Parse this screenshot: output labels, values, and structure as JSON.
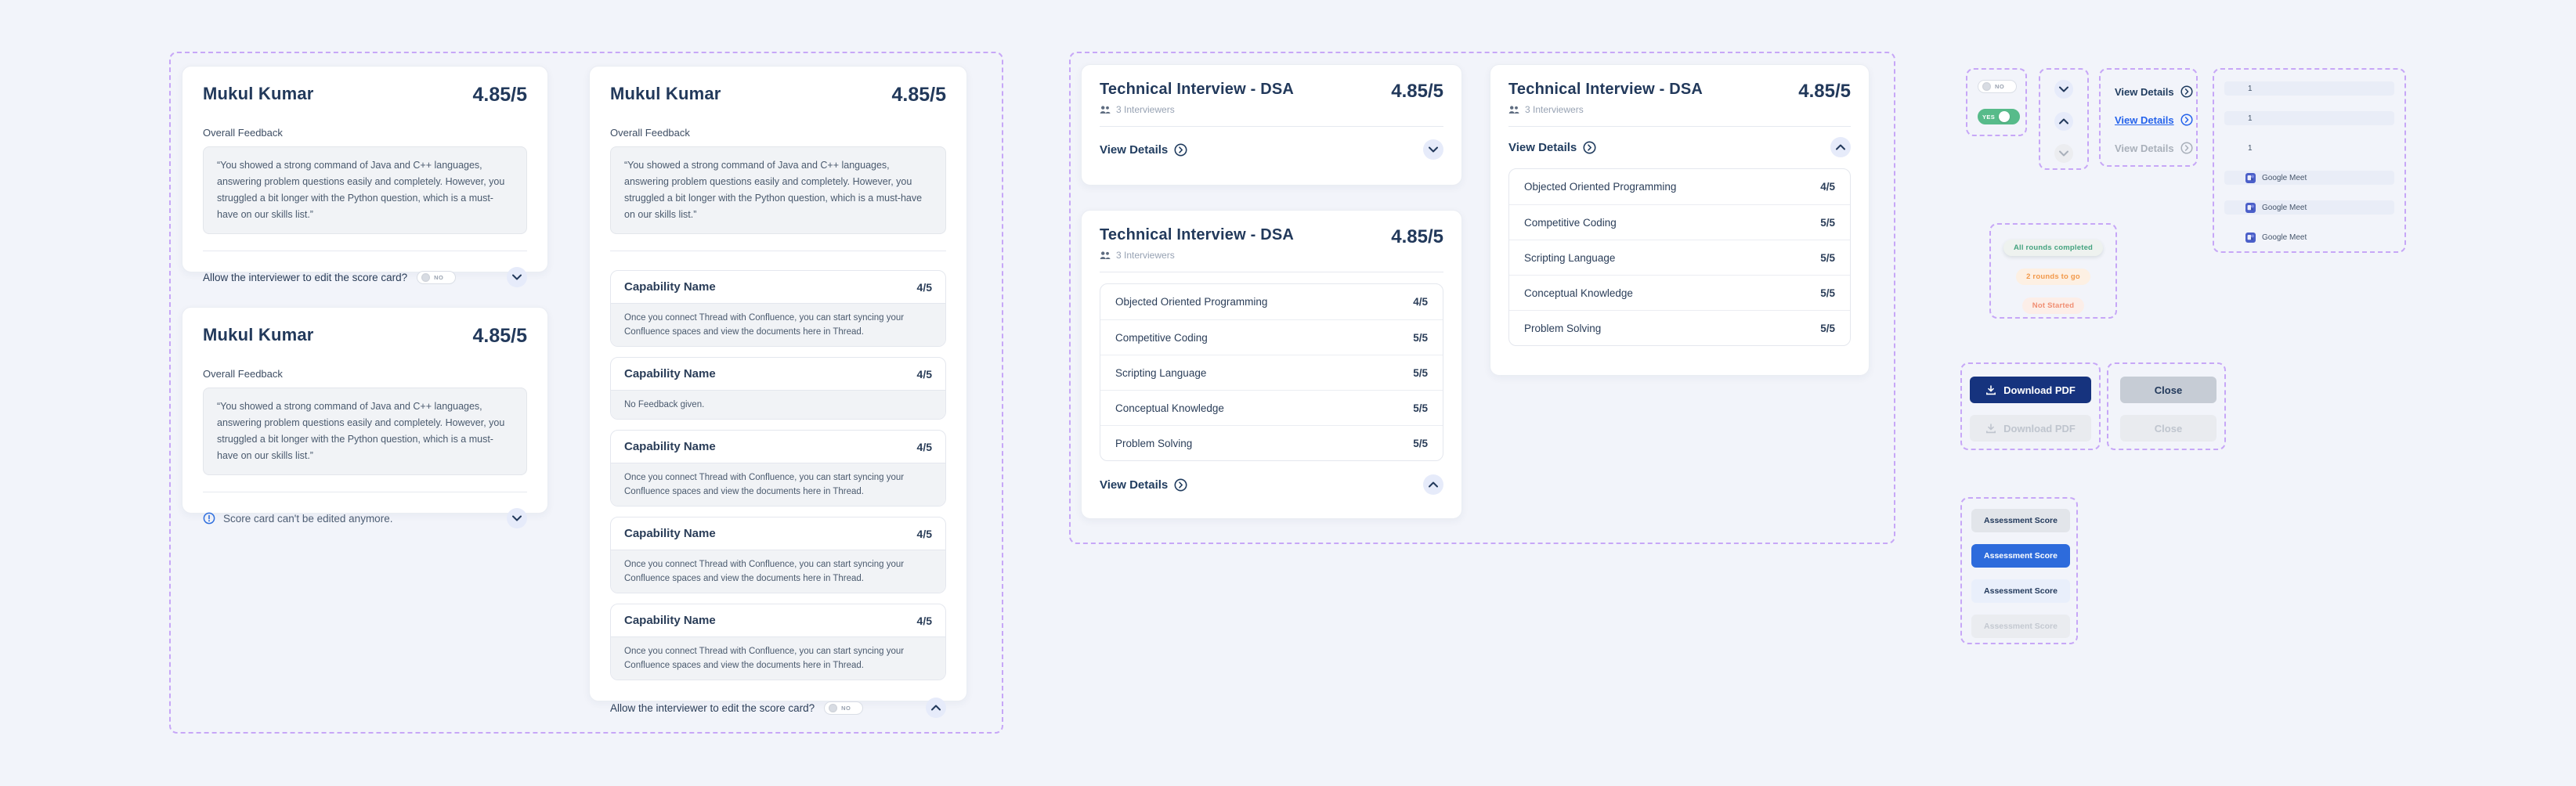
{
  "shared": {
    "candidate_name": "Mukul Kumar",
    "score": "4.85/5",
    "overall_feedback_label": "Overall Feedback",
    "feedback_quote": "“You showed a strong command of Java and C++ languages, answering problem questions easily and completely. However, you struggled a bit longer with the Python question, which is a must-have on our skills list.”",
    "allow_edit_label": "Allow the interviewer to edit the score card?",
    "cant_edit_label": "Score card can't be edited anymore.",
    "toggle_no": "NO",
    "toggle_yes": "YES",
    "interview_title": "Technical Interview - DSA",
    "interviewers_label": "3 Interviewers",
    "view_details_label": "View Details",
    "capability_name": "Capability Name",
    "capability_score": "4/5",
    "capability_feedback": "Once you connect Thread with Confluence, you can start syncing your Confluence spaces and view the documents here in Thread.",
    "no_feedback": "No Feedback given."
  },
  "skills": [
    {
      "label": "Objected Oriented Programming",
      "score": "4/5"
    },
    {
      "label": "Competitive Coding",
      "score": "5/5"
    },
    {
      "label": "Scripting Language",
      "score": "5/5"
    },
    {
      "label": "Conceptual Knowledge",
      "score": "5/5"
    },
    {
      "label": "Problem Solving",
      "score": "5/5"
    }
  ],
  "components": {
    "list_number": "1",
    "meet_label": "Google Meet",
    "status": {
      "completed": "All rounds completed",
      "rounds_to_go": "2 rounds to go",
      "not_started": "Not Started"
    },
    "download_pdf_label": "Download PDF",
    "close_label": "Close",
    "assessment_label": "Assessment Score"
  },
  "colors": {
    "accent_blue": "#2D6BDC",
    "deep_blue": "#16337E",
    "navy": "#22395B",
    "toggle_green": "#57BB8A",
    "status_green": "#44A37F",
    "status_orange": "#F2994A",
    "status_salmon": "#F08E72",
    "link_blue": "#2563EB",
    "dash_purple": "#C7A7F7"
  }
}
